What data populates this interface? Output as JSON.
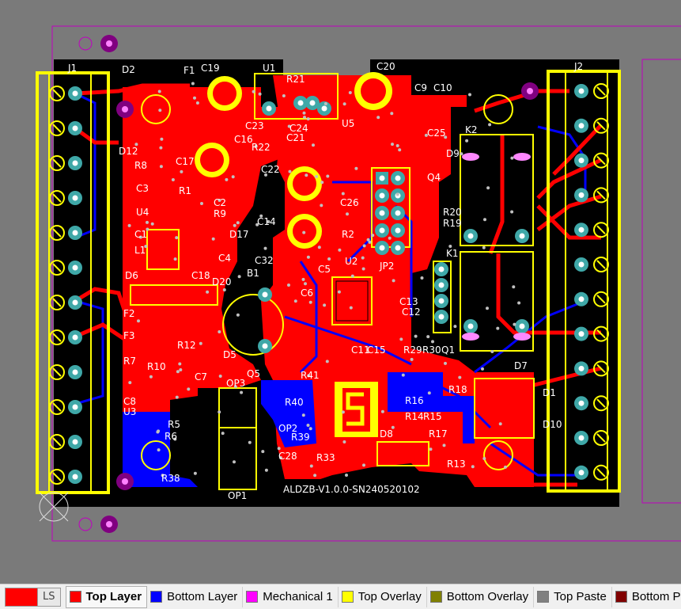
{
  "board": {
    "silkscreen_text": "ALDZB-V1.0.0-SN240520102",
    "designators": [
      "J1",
      "J2",
      "D2",
      "F1",
      "C19",
      "U1",
      "R21",
      "C20",
      "C9",
      "C10",
      "D12",
      "C23",
      "C24",
      "C21",
      "C16",
      "R22",
      "U5",
      "C25",
      "K2",
      "D9",
      "R8",
      "C17",
      "C22",
      "C3",
      "R1",
      "C2",
      "R9",
      "U4",
      "C14",
      "C26",
      "Q4",
      "R20",
      "R19",
      "D17",
      "R2",
      "L1",
      "C4",
      "C32",
      "U2",
      "JP2",
      "K1",
      "D6",
      "C18",
      "D20",
      "C5",
      "C6",
      "F2",
      "F3",
      "B1",
      "C13",
      "C12",
      "D5",
      "R12",
      "R10",
      "R7",
      "C11",
      "C15",
      "R29",
      "R30",
      "Q1",
      "D7",
      "R41",
      "Q5",
      "OP3",
      "R18",
      "R16",
      "D1",
      "C8",
      "U3",
      "C7",
      "R40",
      "R14",
      "R15",
      "D10",
      "R5",
      "R6",
      "OP2",
      "R39",
      "R17",
      "R13",
      "D8",
      "C28",
      "R33",
      "R38",
      "OP1",
      "C1"
    ]
  },
  "statusbar": {
    "ls_label": "LS",
    "layers": [
      {
        "label": "Top Layer",
        "color": "#ff0000",
        "active": true
      },
      {
        "label": "Bottom Layer",
        "color": "#0000ff",
        "active": false
      },
      {
        "label": "Mechanical 1",
        "color": "#ff00ff",
        "active": false
      },
      {
        "label": "Top Overlay",
        "color": "#ffff00",
        "active": false
      },
      {
        "label": "Bottom Overlay",
        "color": "#808000",
        "active": false
      },
      {
        "label": "Top Paste",
        "color": "#808080",
        "active": false
      },
      {
        "label": "Bottom Paste",
        "color": "#800000",
        "active": false
      }
    ]
  },
  "colors": {
    "background": "#7a7a7a",
    "board": "#000000",
    "top_layer": "#ff0000",
    "bottom_layer": "#0000ff",
    "overlay": "#ffff00",
    "mechanical": "#ff00ff",
    "pad": "#3fa8a8"
  }
}
